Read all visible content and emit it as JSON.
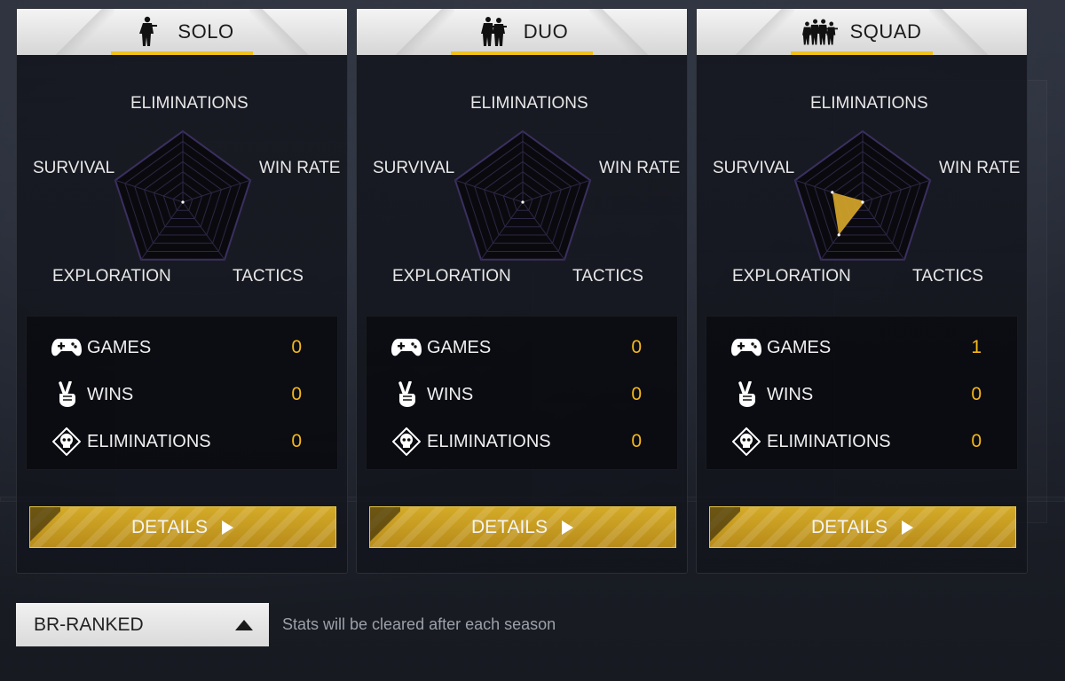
{
  "modes": [
    {
      "title": "SOLO",
      "icon": "solo-soldier-icon",
      "radar": {
        "axes": [
          "ELIMINATIONS",
          "WIN RATE",
          "TACTICS",
          "EXPLORATION",
          "SURVIVAL"
        ],
        "values": [
          0,
          0,
          0,
          0,
          0
        ]
      },
      "stats": [
        {
          "icon": "gamepad-icon",
          "label": "GAMES",
          "value": "0"
        },
        {
          "icon": "victory-hand-icon",
          "label": "WINS",
          "value": "0"
        },
        {
          "icon": "skull-icon",
          "label": "ELIMINATIONS",
          "value": "0"
        }
      ],
      "details_label": "DETAILS"
    },
    {
      "title": "DUO",
      "icon": "duo-soldiers-icon",
      "radar": {
        "axes": [
          "ELIMINATIONS",
          "WIN RATE",
          "TACTICS",
          "EXPLORATION",
          "SURVIVAL"
        ],
        "values": [
          0,
          0,
          0,
          0,
          0
        ]
      },
      "stats": [
        {
          "icon": "gamepad-icon",
          "label": "GAMES",
          "value": "0"
        },
        {
          "icon": "victory-hand-icon",
          "label": "WINS",
          "value": "0"
        },
        {
          "icon": "skull-icon",
          "label": "ELIMINATIONS",
          "value": "0"
        }
      ],
      "details_label": "DETAILS"
    },
    {
      "title": "SQUAD",
      "icon": "squad-soldiers-icon",
      "radar": {
        "axes": [
          "ELIMINATIONS",
          "WIN RATE",
          "TACTICS",
          "EXPLORATION",
          "SURVIVAL"
        ],
        "values": [
          0,
          0,
          0,
          0.57,
          0.45
        ]
      },
      "stats": [
        {
          "icon": "gamepad-icon",
          "label": "GAMES",
          "value": "1"
        },
        {
          "icon": "victory-hand-icon",
          "label": "WINS",
          "value": "0"
        },
        {
          "icon": "skull-icon",
          "label": "ELIMINATIONS",
          "value": "0"
        }
      ],
      "details_label": "DETAILS"
    }
  ],
  "mode_select": {
    "value": "BR-RANKED",
    "icon": "caret-up-icon"
  },
  "footer_note": "Stats will be cleared after each season",
  "colors": {
    "accent": "#f2c21b",
    "value": "#f5b81a",
    "radar_fill": "#d9a82a",
    "radar_grid": "#3a2f5a"
  }
}
